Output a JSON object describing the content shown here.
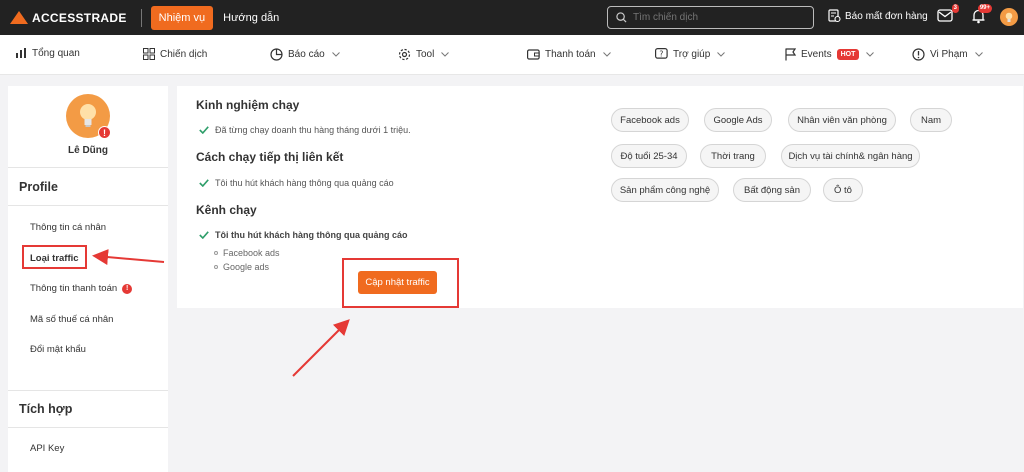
{
  "header": {
    "logo_text": "ACCESSTRADE",
    "mission_label": "Nhiệm vụ",
    "guide_label": "Hướng dẫn",
    "search_placeholder": "Tìm chiến dịch",
    "report_label": "Báo mất đơn hàng",
    "mail_badge": "3",
    "bell_badge": "99+"
  },
  "nav": {
    "overview": "Tổng quan",
    "campaigns": "Chiến dịch",
    "reports": "Báo cáo",
    "tool": "Tool",
    "payment": "Thanh toán",
    "help": "Trợ giúp",
    "events": "Events",
    "hot_badge": "HOT",
    "violations": "Vi Phạm"
  },
  "sidebar": {
    "user_name": "Lê Dũng",
    "profile_title": "Profile",
    "items": [
      "Thông tin cá nhân",
      "Loại traffic",
      "Thông tin thanh toán",
      "Mã số thuế cá nhân",
      "Đổi mật khẩu"
    ],
    "integration_title": "Tích hợp",
    "api_key": "API Key"
  },
  "main": {
    "exp_title": "Kinh nghiệm chạy",
    "exp_text": "Đã từng chạy doanh thu hàng tháng dưới 1 triệu.",
    "method_title": "Cách chạy tiếp thị liên kết",
    "method_text": "Tôi thu hút khách hàng thông qua quảng cáo",
    "channel_title": "Kênh chạy",
    "channel_text": "Tôi thu hút khách hàng thông qua quảng cáo",
    "channels": [
      "Facebook ads",
      "Google ads"
    ],
    "update_button": "Cập nhật traffic",
    "tags": [
      "Facebook ads",
      "Google Ads",
      "Nhân viên văn phòng",
      "Nam",
      "Độ tuổi 25-34",
      "Thời trang",
      "Dịch vụ tài chính& ngân hàng",
      "Sản phẩm công nghệ",
      "Bất động sản",
      "Ô tô"
    ]
  },
  "colors": {
    "brand": "#f06b1f",
    "highlight": "#e53935",
    "check": "#2e9e6a"
  }
}
